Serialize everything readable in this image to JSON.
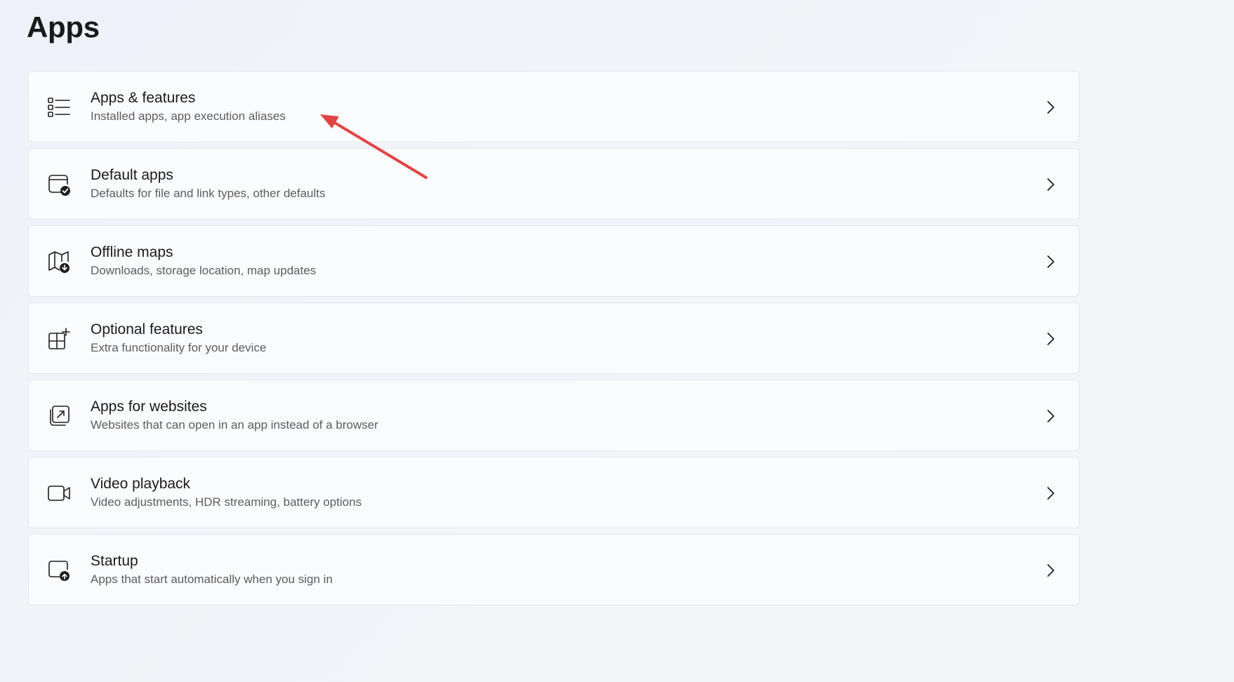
{
  "page": {
    "title": "Apps"
  },
  "items": [
    {
      "title": "Apps & features",
      "subtitle": "Installed apps, app execution aliases",
      "icon": "list-icon"
    },
    {
      "title": "Default apps",
      "subtitle": "Defaults for file and link types, other defaults",
      "icon": "default-apps-icon"
    },
    {
      "title": "Offline maps",
      "subtitle": "Downloads, storage location, map updates",
      "icon": "map-download-icon"
    },
    {
      "title": "Optional features",
      "subtitle": "Extra functionality for your device",
      "icon": "add-grid-icon"
    },
    {
      "title": "Apps for websites",
      "subtitle": "Websites that can open in an app instead of a browser",
      "icon": "open-in-app-icon"
    },
    {
      "title": "Video playback",
      "subtitle": "Video adjustments, HDR streaming, battery options",
      "icon": "video-camera-icon"
    },
    {
      "title": "Startup",
      "subtitle": "Apps that start automatically when you sign in",
      "icon": "startup-icon"
    }
  ],
  "colors": {
    "annotation_arrow": "#e04444",
    "background": "#f0f3f8",
    "card_background": "#fafbfd",
    "card_border": "#e3e6ec"
  }
}
